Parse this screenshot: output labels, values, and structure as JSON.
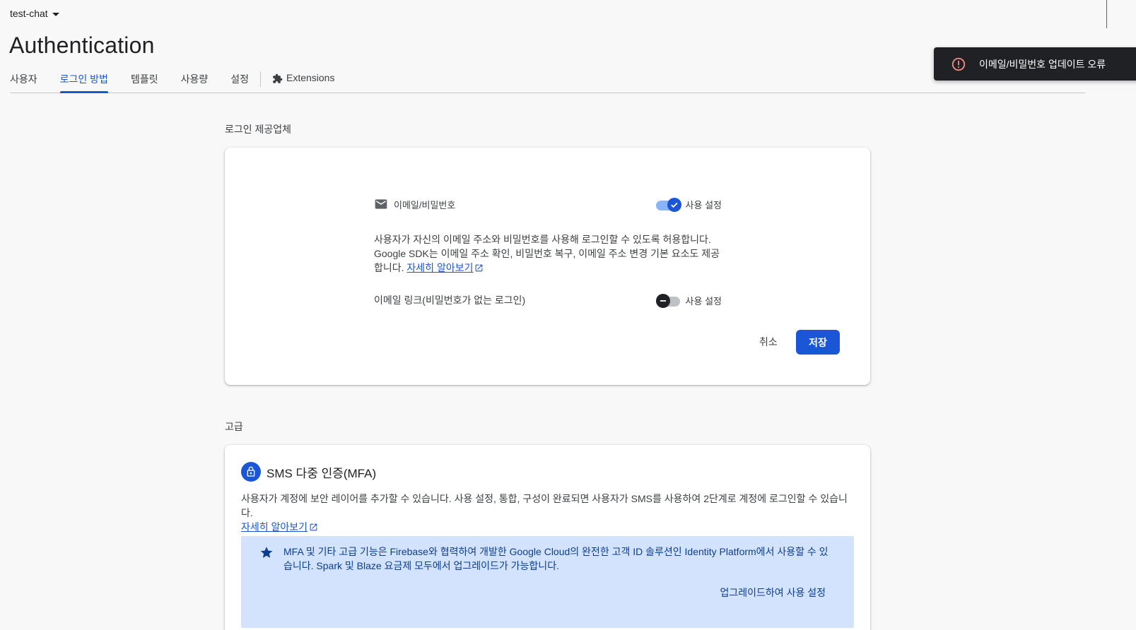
{
  "header": {
    "project_name": "test-chat",
    "page_title": "Authentication"
  },
  "tabs": [
    {
      "label": "사용자"
    },
    {
      "label": "로그인 방법"
    },
    {
      "label": "템플릿"
    },
    {
      "label": "사용량"
    },
    {
      "label": "설정"
    },
    {
      "label": "Extensions"
    }
  ],
  "toast": {
    "message": "이메일/비밀번호 업데이트 오류"
  },
  "providers_section": {
    "label": "로그인 제공업체",
    "provider_name": "이메일/비밀번호",
    "enable_label": "사용 설정",
    "enabled": true,
    "description": "사용자가 자신의 이메일 주소와 비밀번호를 사용해 로그인할 수 있도록 허용합니다. Google SDK는 이메일 주소 확인, 비밀번호 복구, 이메일 주소 변경 기본 요소도 제공합니다.",
    "learn_more": "자세히 알아보기",
    "email_link_label": "이메일 링크(비밀번호가 없는 로그인)",
    "email_link_enable_label": "사용 설정",
    "email_link_enabled": false,
    "cancel_label": "취소",
    "save_label": "저장"
  },
  "advanced_section": {
    "label": "고급",
    "mfa_title": "SMS 다중 인증(MFA)",
    "mfa_description": "사용자가 계정에 보안 레이어를 추가할 수 있습니다. 사용 설정, 통합, 구성이 완료되면 사용자가 SMS를 사용하여 2단계로 계정에 로그인할 수 있습니다.",
    "learn_more": "자세히 알아보기",
    "promo_text": "MFA 및 기타 고급 기능은 Firebase와 협력하여 개발한 Google Cloud의 완전한 고객 ID 솔루션인 Identity Platform에서 사용할 수 있습니다. Spark 및 Blaze 요금제 모두에서 업그레이드가 가능합니다.",
    "upgrade_label": "업그레이드하여 사용 설정"
  },
  "colors": {
    "accent": "#1a56d6",
    "toast_bg": "#202124",
    "promo_bg": "#d3e3fd"
  }
}
